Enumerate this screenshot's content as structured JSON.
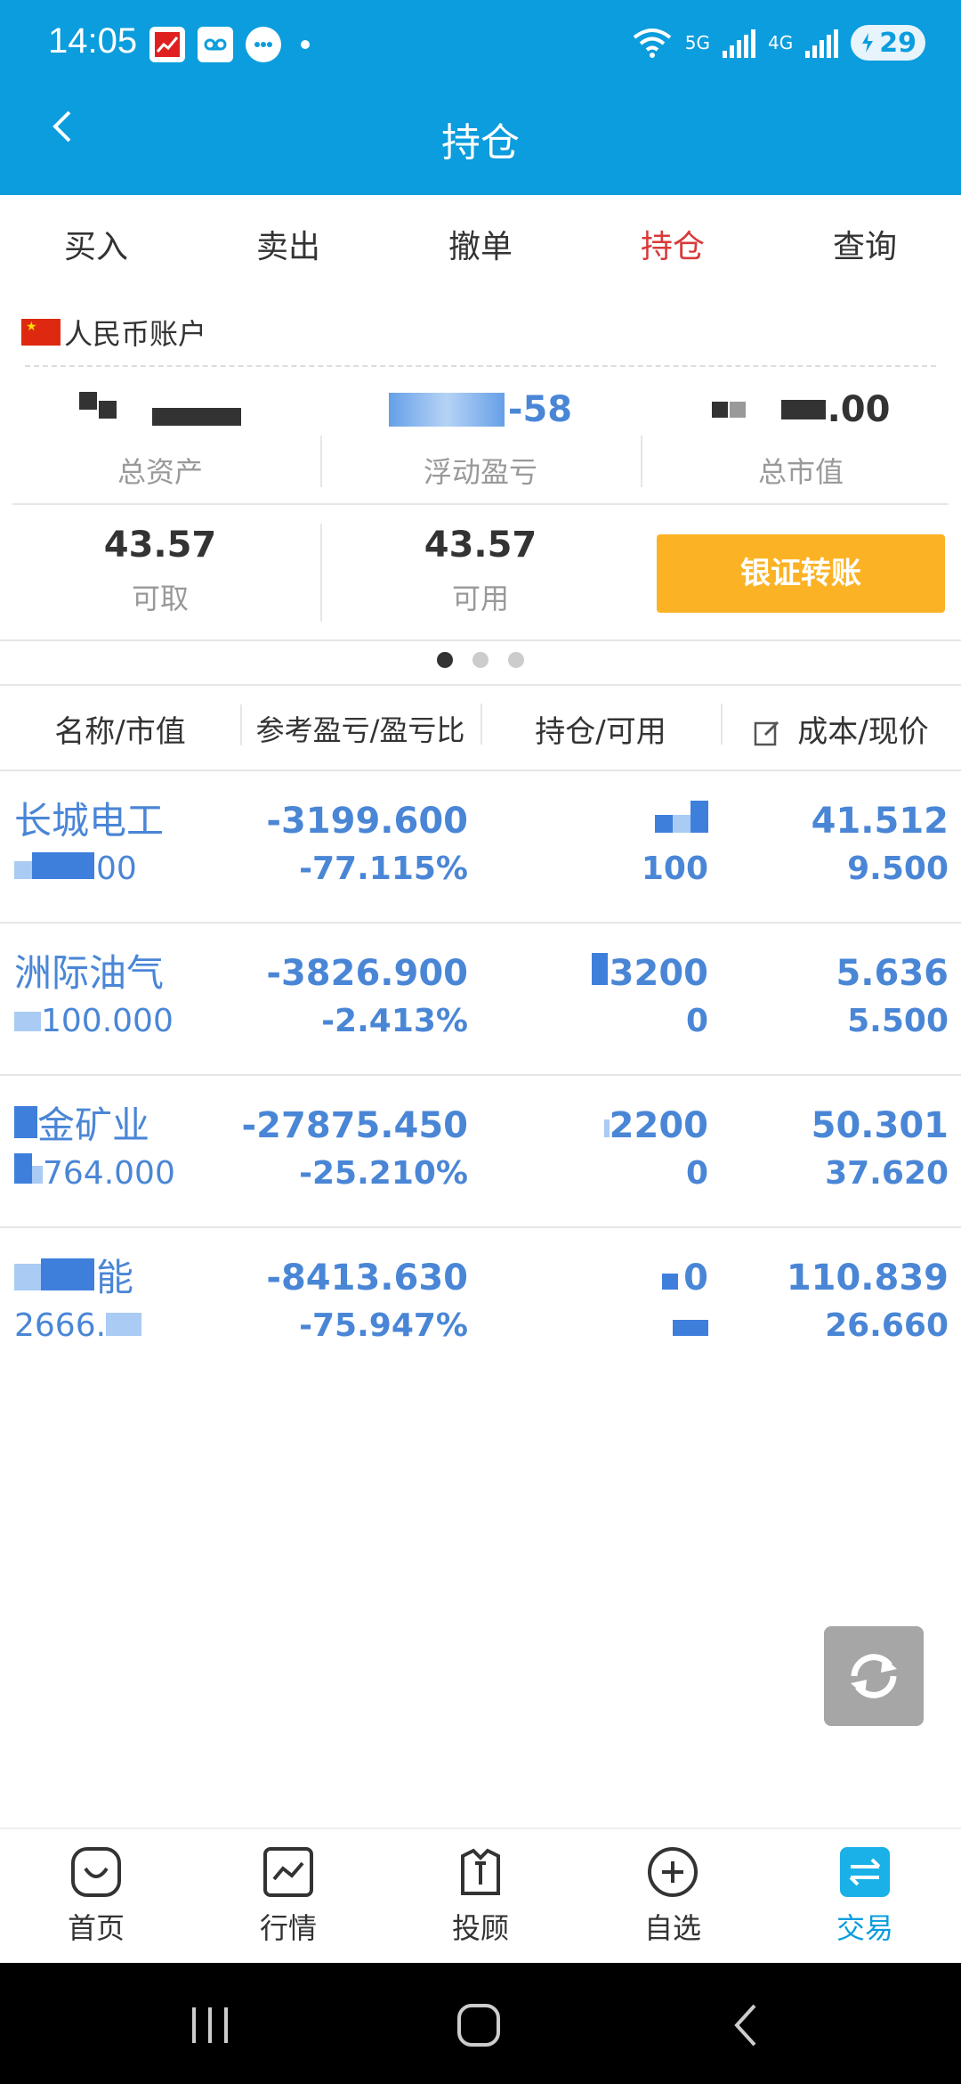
{
  "status_bar": {
    "time": "14:05",
    "network_5g": "5G",
    "network_4g": "4G",
    "battery": "29",
    "icons": [
      "stock-app-icon",
      "voicemail-icon",
      "message-icon",
      "wifi-icon",
      "signal-icon",
      "battery-icon"
    ]
  },
  "header": {
    "title": "持仓",
    "back_icon": "chevron-left-icon"
  },
  "trade_tabs": [
    {
      "label": "买入",
      "active": false
    },
    {
      "label": "卖出",
      "active": false
    },
    {
      "label": "撤单",
      "active": false
    },
    {
      "label": "持仓",
      "active": true
    },
    {
      "label": "查询",
      "active": false
    }
  ],
  "account": {
    "label": "人民币账户",
    "summary": [
      {
        "label": "总资产",
        "value": ""
      },
      {
        "label": "浮动盈亏",
        "value": "-58"
      },
      {
        "label": "总市值",
        "value": ".00"
      }
    ],
    "withdrawable": {
      "label": "可取",
      "value": "43.57"
    },
    "usable": {
      "label": "可用",
      "value": "43.57"
    },
    "transfer_button": "银证转账",
    "page_dots": 3,
    "page_active": 0
  },
  "table": {
    "headers": [
      "名称/市值",
      "参考盈亏/盈亏比",
      "持仓/可用",
      "成本/现价"
    ],
    "rows": [
      {
        "name": "长城电工",
        "market_value": "00",
        "pnl": "-3199.600",
        "pnl_ratio": "-77.115%",
        "holding": "",
        "available": "100",
        "cost": "41.512",
        "price": "9.500"
      },
      {
        "name": "洲际油气",
        "market_value": "100.000",
        "pnl": "-3826.900",
        "pnl_ratio": "-2.413%",
        "holding": "3200",
        "available": "0",
        "cost": "5.636",
        "price": "5.500"
      },
      {
        "name": "金矿业",
        "market_value": "764.000",
        "pnl": "-27875.450",
        "pnl_ratio": "-25.210%",
        "holding": "2200",
        "available": "0",
        "cost": "50.301",
        "price": "37.620"
      },
      {
        "name": "能",
        "market_value": "2666.",
        "pnl": "-8413.630",
        "pnl_ratio": "-75.947%",
        "holding": "0",
        "available": "",
        "cost": "110.839",
        "price": "26.660"
      }
    ]
  },
  "bottom_nav": [
    {
      "label": "首页",
      "icon": "home-icon",
      "active": false
    },
    {
      "label": "行情",
      "icon": "market-chart-icon",
      "active": false
    },
    {
      "label": "投顾",
      "icon": "advisor-icon",
      "active": false
    },
    {
      "label": "自选",
      "icon": "add-circle-icon",
      "active": false
    },
    {
      "label": "交易",
      "icon": "exchange-icon",
      "active": true
    }
  ],
  "colors": {
    "header_bg": "#0b9ddd",
    "active_tab": "#d83a3a",
    "transfer_button": "#fbb224",
    "position_text": "#4a86d6",
    "nav_active": "#0b9ddd"
  }
}
